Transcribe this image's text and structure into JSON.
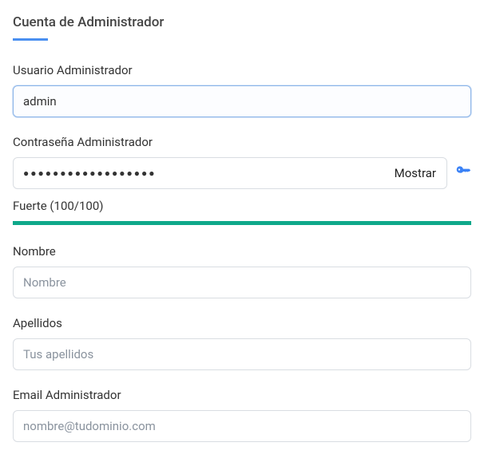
{
  "section": {
    "title": "Cuenta de Administrador"
  },
  "fields": {
    "username": {
      "label": "Usuario Administrador",
      "value": "admin"
    },
    "password": {
      "label": "Contraseña Administrador",
      "value": "●●●●●●●●●●●●●●●●●●",
      "show_label": "Mostrar"
    },
    "strength": {
      "label": "Fuerte (100/100)",
      "score": 100,
      "color": "#0fa88a"
    },
    "firstname": {
      "label": "Nombre",
      "placeholder": "Nombre"
    },
    "lastname": {
      "label": "Apellidos",
      "placeholder": "Tus apellidos"
    },
    "email": {
      "label": "Email Administrador",
      "placeholder": "nombre@tudominio.com"
    }
  }
}
